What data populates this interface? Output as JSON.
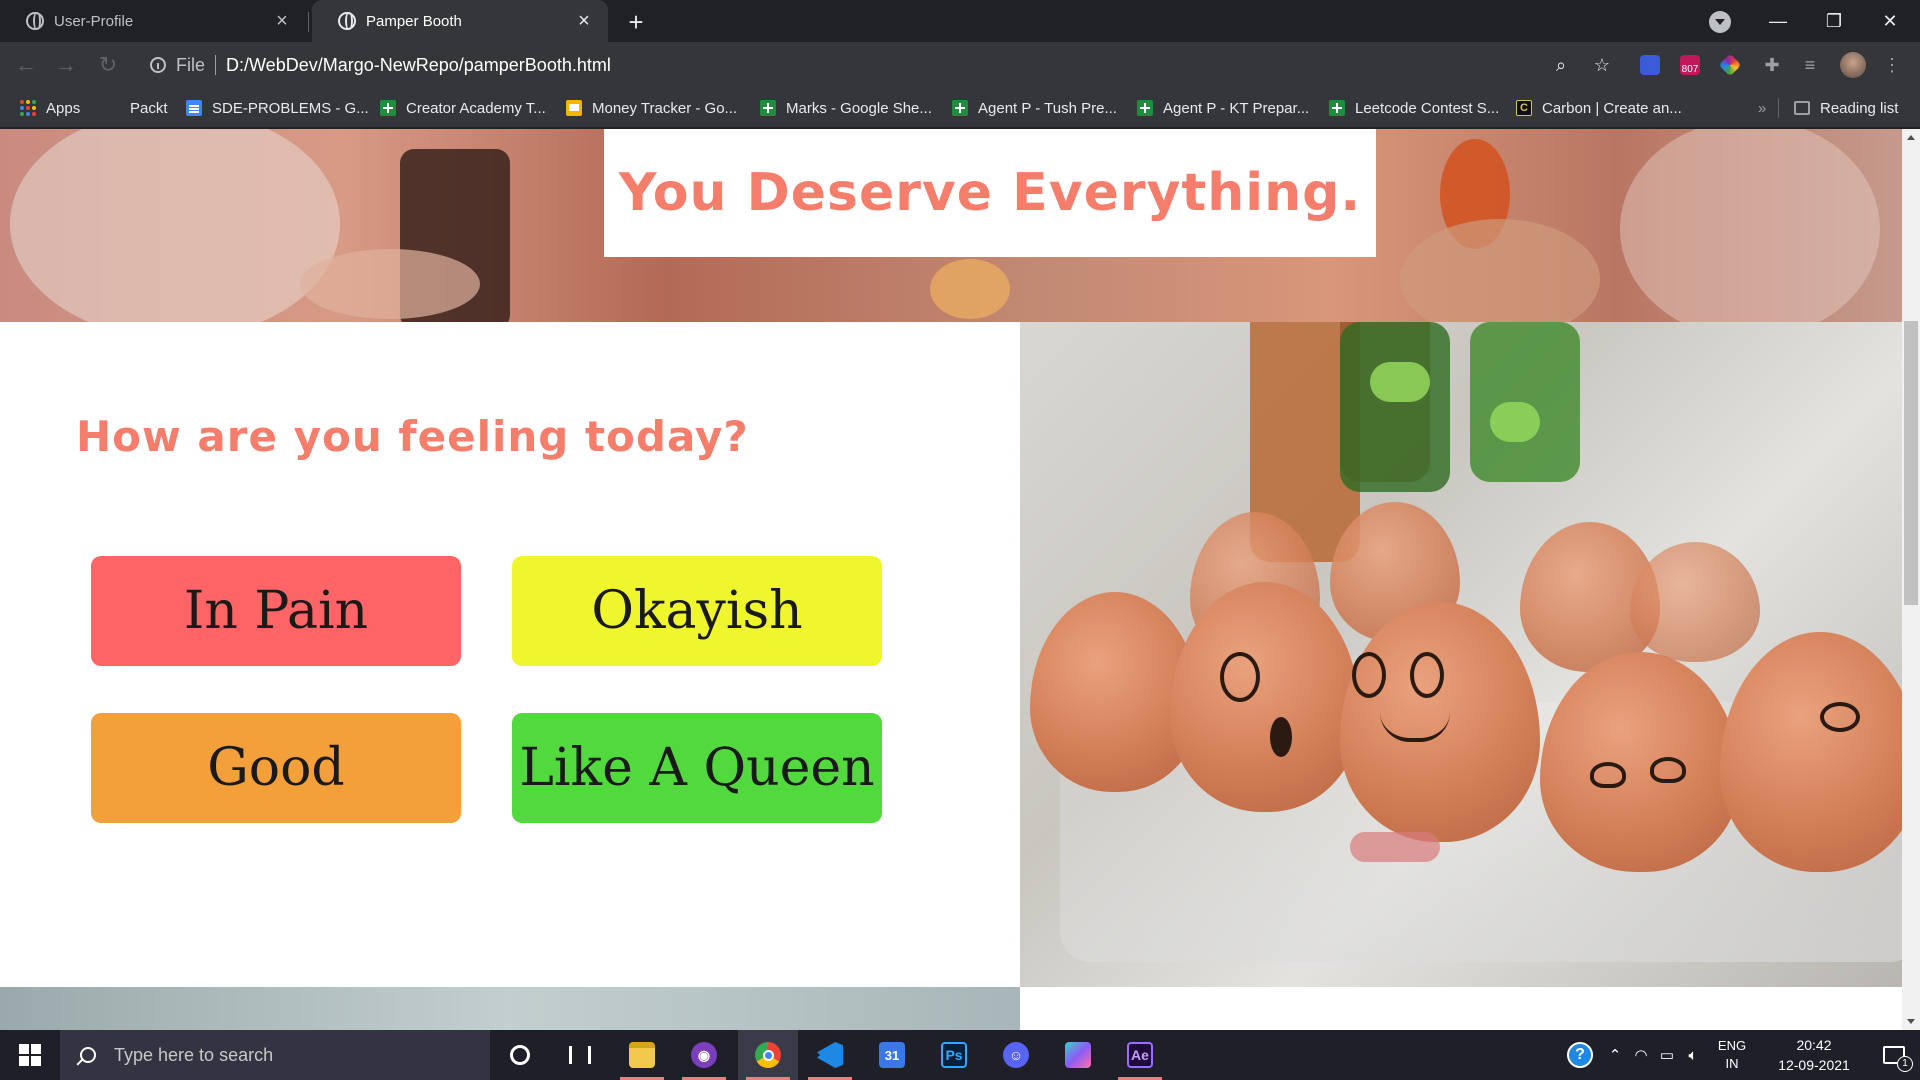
{
  "browser": {
    "tabs": [
      {
        "title": "User-Profile",
        "active": false
      },
      {
        "title": "Pamper Booth",
        "active": true
      }
    ],
    "address": {
      "scheme_label": "File",
      "url": "D:/WebDev/Margo-NewRepo/pamperBooth.html"
    },
    "extension_badge": "807",
    "bookmarks": [
      {
        "label": "Apps",
        "icon": "apps-grid-icon"
      },
      {
        "label": "Packt",
        "icon": "none"
      },
      {
        "label": "SDE-PROBLEMS - G...",
        "icon": "google-docs-icon"
      },
      {
        "label": "Creator Academy T...",
        "icon": "google-sheets-icon"
      },
      {
        "label": "Money Tracker - Go...",
        "icon": "google-slides-icon"
      },
      {
        "label": "Marks - Google She...",
        "icon": "google-sheets-icon"
      },
      {
        "label": "Agent P - Tush Pre...",
        "icon": "google-sheets-icon"
      },
      {
        "label": "Agent P - KT Prepar...",
        "icon": "google-sheets-icon"
      },
      {
        "label": "Leetcode Contest S...",
        "icon": "google-sheets-icon"
      },
      {
        "label": "Carbon | Create an...",
        "icon": "carbon-icon"
      }
    ],
    "overflow_label": "»",
    "reading_list": "Reading list"
  },
  "page": {
    "hero_title": "You Deserve Everything.",
    "feeling_heading": "How are you feeling today?",
    "moods": [
      {
        "label": "In Pain",
        "color": "#ff6566"
      },
      {
        "label": "Okayish",
        "color": "#f0f62e"
      },
      {
        "label": "Good",
        "color": "#f4a03a"
      },
      {
        "label": "Like A Queen",
        "color": "#52d93e"
      }
    ],
    "accent_color": "#f47e6b"
  },
  "taskbar": {
    "search_placeholder": "Type here to search",
    "language": "ENG",
    "region": "IN",
    "time": "20:42",
    "date": "12-09-2021",
    "notification_count": "1"
  }
}
